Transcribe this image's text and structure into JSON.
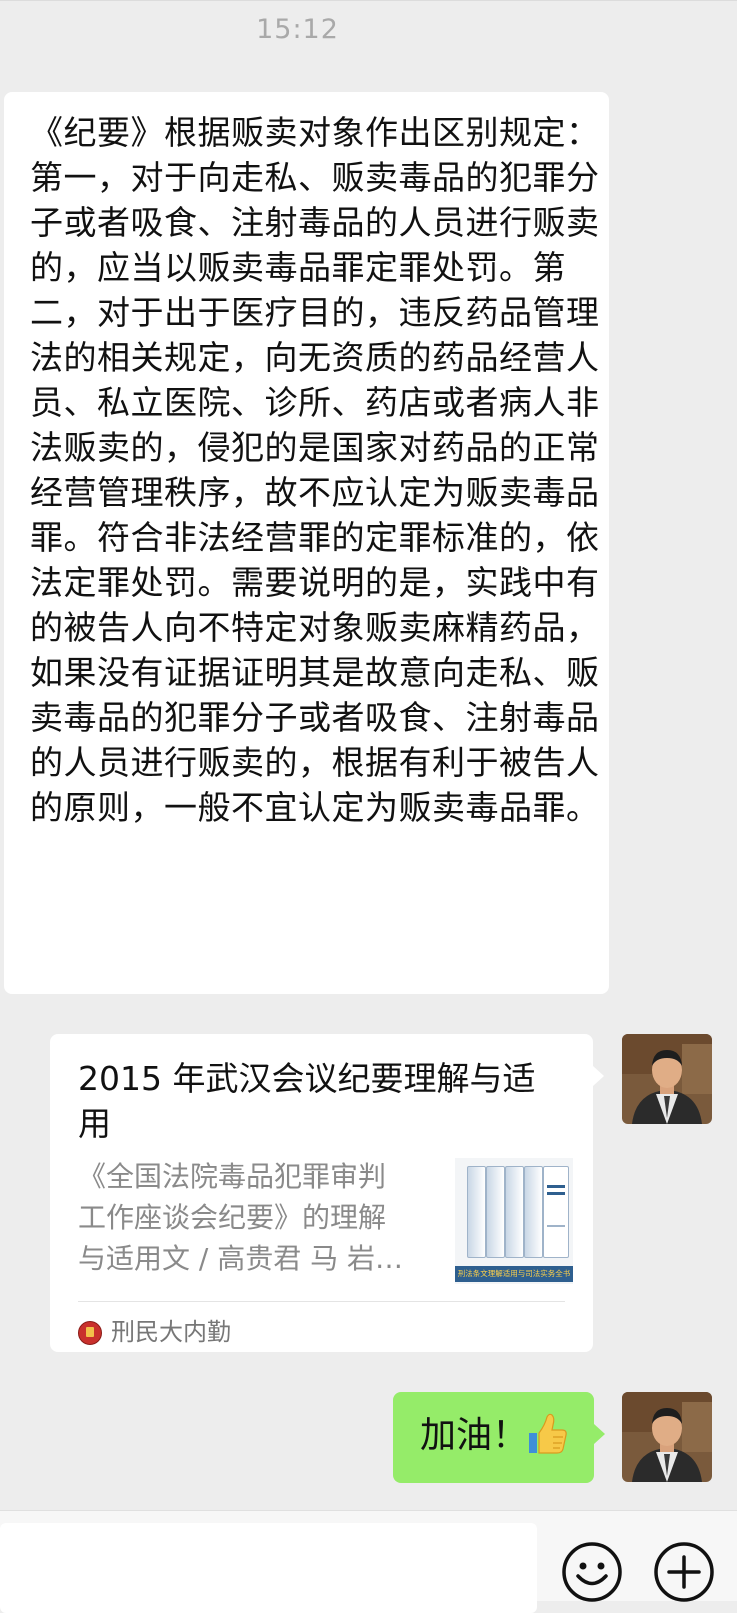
{
  "timestamp": "15:12",
  "received_message": {
    "text": "《纪要》根据贩卖对象作出区别规定：第一，对于向走私、贩卖毒品的犯罪分子或者吸食、注射毒品的人员进行贩卖的，应当以贩卖毒品罪定罪处罚。第二，对于出于医疗目的，违反药品管理法的相关规定，向无资质的药品经营人员、私立医院、诊所、药店或者病人非法贩卖的，侵犯的是国家对药品的正常经营管理秩序，故不应认定为贩卖毒品罪。符合非法经营罪的定罪标准的，依法定罪处罚。需要说明的是，实践中有的被告人向不特定对象贩卖麻精药品，如果没有证据证明其是故意向走私、贩卖毒品的犯罪分子或者吸食、注射毒品的人员进行贩卖的，根据有利于被告人的原则，一般不宜认定为贩卖毒品罪。"
  },
  "article_card": {
    "title": "2015 年武汉会议纪要理解与适用",
    "description": "《全国法院毒品犯罪审判工作座谈会纪要》的理解与适用文 / 高贵君 马 岩…",
    "thumbnail_caption": "刑法条文理解适用与司法实务全书",
    "source_name": "刑民大内勤"
  },
  "sent_message": {
    "text": "加油！",
    "emoji": "thumbs-up"
  },
  "input_bar": {
    "emoji_icon": "smiley-icon",
    "plus_icon": "plus-circle-icon"
  },
  "colors": {
    "background": "#ededed",
    "sent_bubble": "#95ec69",
    "received_bubble": "#ffffff",
    "timestamp": "#a9a9a9"
  }
}
